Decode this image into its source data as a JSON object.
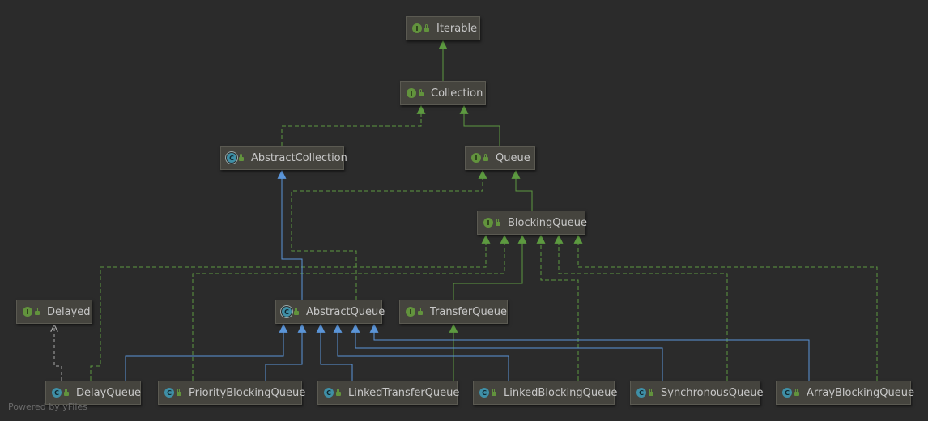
{
  "nodes": {
    "iterable": {
      "label": "Iterable",
      "kind": "I"
    },
    "collection": {
      "label": "Collection",
      "kind": "I"
    },
    "abstract_collection": {
      "label": "AbstractCollection",
      "kind": "C"
    },
    "queue": {
      "label": "Queue",
      "kind": "I"
    },
    "blocking_queue": {
      "label": "BlockingQueue",
      "kind": "I"
    },
    "delayed": {
      "label": "Delayed",
      "kind": "I"
    },
    "abstract_queue": {
      "label": "AbstractQueue",
      "kind": "C"
    },
    "transfer_queue": {
      "label": "TransferQueue",
      "kind": "I"
    },
    "delay_queue": {
      "label": "DelayQueue",
      "kind": "C"
    },
    "priority_blocking_queue": {
      "label": "PriorityBlockingQueue",
      "kind": "C"
    },
    "linked_transfer_queue": {
      "label": "LinkedTransferQueue",
      "kind": "C"
    },
    "linked_blocking_queue": {
      "label": "LinkedBlockingQueue",
      "kind": "C"
    },
    "synchronous_queue": {
      "label": "SynchronousQueue",
      "kind": "C"
    },
    "array_blocking_queue": {
      "label": "ArrayBlockingQueue",
      "kind": "C"
    }
  },
  "colors": {
    "background": "#2b2b2b",
    "node_fill": "#45443e",
    "interface_icon": "#62933d",
    "class_icon": "#3f8fa6",
    "interface_edge": "#5d9a40",
    "class_edge": "#5b95d8",
    "delayed_edge": "#aaaaaa"
  },
  "footer": {
    "credit": "Powered by yFiles"
  }
}
